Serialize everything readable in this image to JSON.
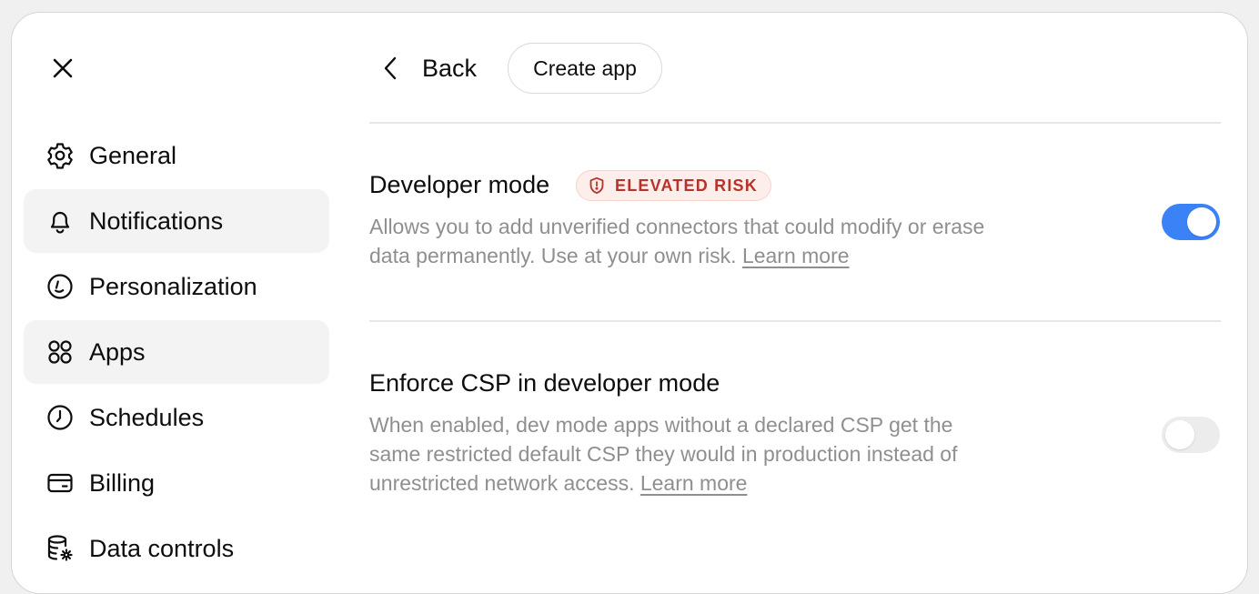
{
  "sidebar": {
    "close_label": "close",
    "items": [
      {
        "label": "General",
        "icon": "gear-icon"
      },
      {
        "label": "Notifications",
        "icon": "bell-icon"
      },
      {
        "label": "Personalization",
        "icon": "personalization-icon"
      },
      {
        "label": "Apps",
        "icon": "apps-grid-icon"
      },
      {
        "label": "Schedules",
        "icon": "clock-icon"
      },
      {
        "label": "Billing",
        "icon": "credit-card-icon"
      },
      {
        "label": "Data controls",
        "icon": "database-gear-icon"
      }
    ]
  },
  "header": {
    "back_label": "Back",
    "create_app_label": "Create app"
  },
  "settings": {
    "developer_mode": {
      "title": "Developer mode",
      "badge": "ELEVATED RISK",
      "description": "Allows you to add unverified connectors that could modify or erase data permanently. Use at your own risk.",
      "link": "Learn more",
      "enabled": true
    },
    "enforce_csp": {
      "title": "Enforce CSP in developer mode",
      "description": "When enabled, dev mode apps without a declared CSP get the same restricted default CSP they would in production instead of unrestricted network access.",
      "link": "Learn more",
      "enabled": false
    }
  },
  "colors": {
    "accent": "#3b82f6",
    "risk_text": "#b8322a",
    "risk_bg": "#fdeeec",
    "muted_text": "#8f8f8f"
  }
}
